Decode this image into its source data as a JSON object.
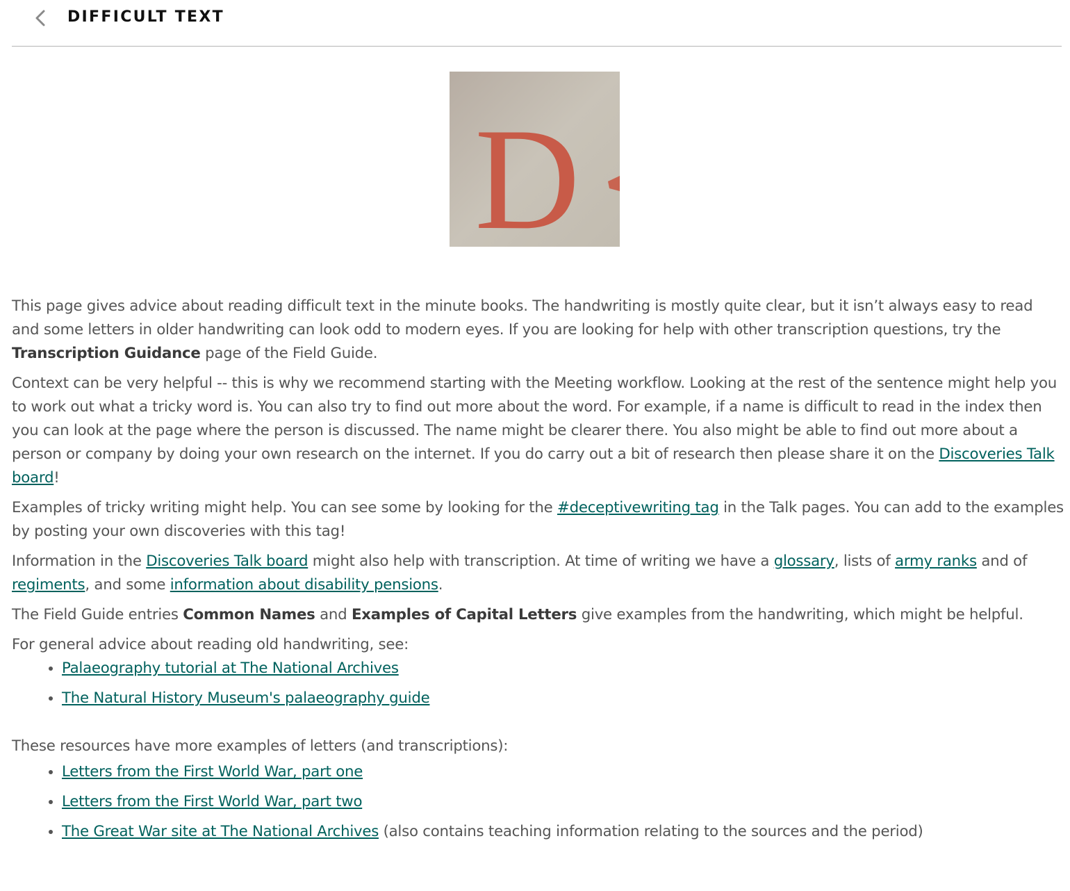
{
  "header": {
    "title": "DIFFICULT TEXT",
    "back_icon": "chevron-left-icon"
  },
  "hero_image": {
    "letter": "D"
  },
  "intro": {
    "text1": "This page gives advice about reading difficult text in the minute books. The handwriting is mostly quite clear, but it isn’t always easy to read and some letters in older handwriting can look odd to modern eyes. If you are looking for help with other transcription questions, try the ",
    "bold1": "Transcription Guidance",
    "text2": " page of the Field Guide."
  },
  "context": {
    "text1": "Context can be very helpful -- this is why we recommend starting with the Meeting workflow. Looking at the rest of the sentence might help you to work out what a tricky word is. You can also try to find out more about the word. For example, if a name is difficult to read in the index then you can look at the page where the person is discussed. The name might be clearer there. You also might be able to find out more about a person or company by doing your own research on the internet. If you do carry out a bit of research then please share it on the ",
    "link1": "Discoveries Talk board",
    "text2": "!"
  },
  "examples": {
    "text1": "Examples of tricky writing might help. You can see some by looking for the ",
    "link1": "#deceptivewriting tag",
    "text2": " in the Talk pages. You can add to the examples by posting your own discoveries with this tag!"
  },
  "information": {
    "text1": "Information in the ",
    "link1": "Discoveries Talk board",
    "text2": " might also help with transcription. At time of writing we have a ",
    "link2": "glossary",
    "text3": ", lists of ",
    "link3": "army ranks",
    "text4": " and of ",
    "link4": "regiments",
    "text5": ", and some ",
    "link5": "information about disability pensions",
    "text6": "."
  },
  "field_guide": {
    "text1": "The Field Guide entries ",
    "bold1": "Common Names",
    "text2": " and ",
    "bold2": "Examples of Capital Letters",
    "text3": " give examples from the handwriting, which might be helpful."
  },
  "general_advice": {
    "intro": "For general advice about reading old handwriting, see:",
    "links": [
      {
        "label": "Palaeography tutorial at The National Archives",
        "suffix": ""
      },
      {
        "label": "The Natural History Museum's palaeography guide",
        "suffix": ""
      }
    ]
  },
  "resources": {
    "intro": "These resources have more examples of letters (and transcriptions):",
    "links": [
      {
        "label": "Letters from the First World War, part one",
        "suffix": ""
      },
      {
        "label": "Letters from the First World War, part two",
        "suffix": ""
      },
      {
        "label": "The Great War site at The National Archives",
        "suffix": " (also contains teaching information relating to the sources and the period)"
      }
    ]
  },
  "colors": {
    "link": "#00615d",
    "text": "#555555",
    "title": "#111111"
  }
}
